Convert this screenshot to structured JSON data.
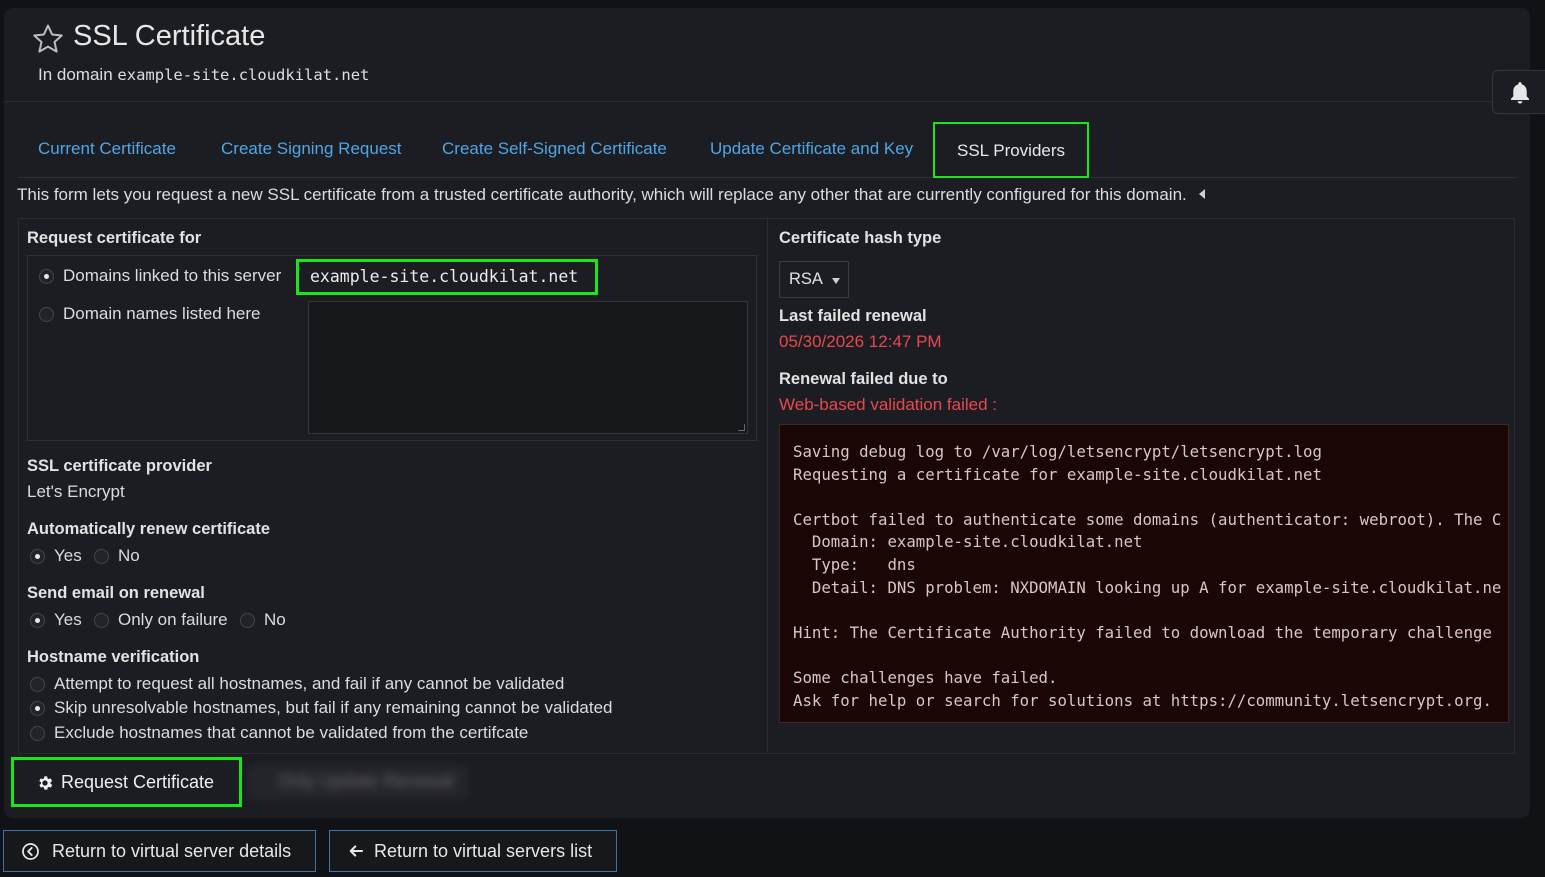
{
  "header": {
    "title": "SSL Certificate",
    "subtitle_prefix": "In domain",
    "domain": "example-site.cloudkilat.net"
  },
  "tabs": [
    {
      "label": "Current Certificate",
      "active": false
    },
    {
      "label": "Create Signing Request",
      "active": false
    },
    {
      "label": "Create Self-Signed Certificate",
      "active": false
    },
    {
      "label": "Update Certificate and Key",
      "active": false
    },
    {
      "label": "SSL Providers",
      "active": true
    }
  ],
  "description": "This form lets you request a new SSL certificate from a trusted certificate authority, which will replace any other that are currently configured for this domain.",
  "left": {
    "request_for": {
      "label": "Request certificate for",
      "option_linked": "Domains linked to this server",
      "linked_value": "example-site.cloudkilat.net",
      "option_listed": "Domain names listed here",
      "selected": "linked"
    },
    "provider": {
      "label": "SSL certificate provider",
      "value": "Let's Encrypt"
    },
    "auto_renew": {
      "label": "Automatically renew certificate",
      "options": [
        "Yes",
        "No"
      ],
      "selected": "Yes"
    },
    "email": {
      "label": "Send email on renewal",
      "options": [
        "Yes",
        "Only on failure",
        "No"
      ],
      "selected": "Yes"
    },
    "hostname": {
      "label": "Hostname verification",
      "options": [
        "Attempt to request all hostnames, and fail if any cannot be validated",
        "Skip unresolvable hostnames, but fail if any remaining cannot be validated",
        "Exclude hostnames that cannot be validated from the certifcate"
      ],
      "selected": 1
    }
  },
  "right": {
    "hash": {
      "label": "Certificate hash type",
      "value": "RSA"
    },
    "last_failed": {
      "label": "Last failed renewal",
      "value": "05/30/2026 12:47 PM"
    },
    "failed_due": {
      "label": "Renewal failed due to",
      "reason": "Web-based validation failed :"
    },
    "log": "Saving debug log to /var/log/letsencrypt/letsencrypt.log\nRequesting a certificate for example-site.cloudkilat.net\n\nCertbot failed to authenticate some domains (authenticator: webroot). The C\n  Domain: example-site.cloudkilat.net\n  Type:   dns\n  Detail: DNS problem: NXDOMAIN looking up A for example-site.cloudkilat.ne\n\nHint: The Certificate Authority failed to download the temporary challenge\n\nSome challenges have failed.\nAsk for help or search for solutions at https://community.letsencrypt.org."
  },
  "actions": {
    "request_label": "Request Certificate",
    "secondary_label": "Only Update Renewal"
  },
  "nav": {
    "back_details": "Return to virtual server details",
    "back_list": "Return to virtual servers list"
  },
  "colors": {
    "highlight": "#19e619",
    "link": "#4ea6e6",
    "error": "#e8484d"
  }
}
